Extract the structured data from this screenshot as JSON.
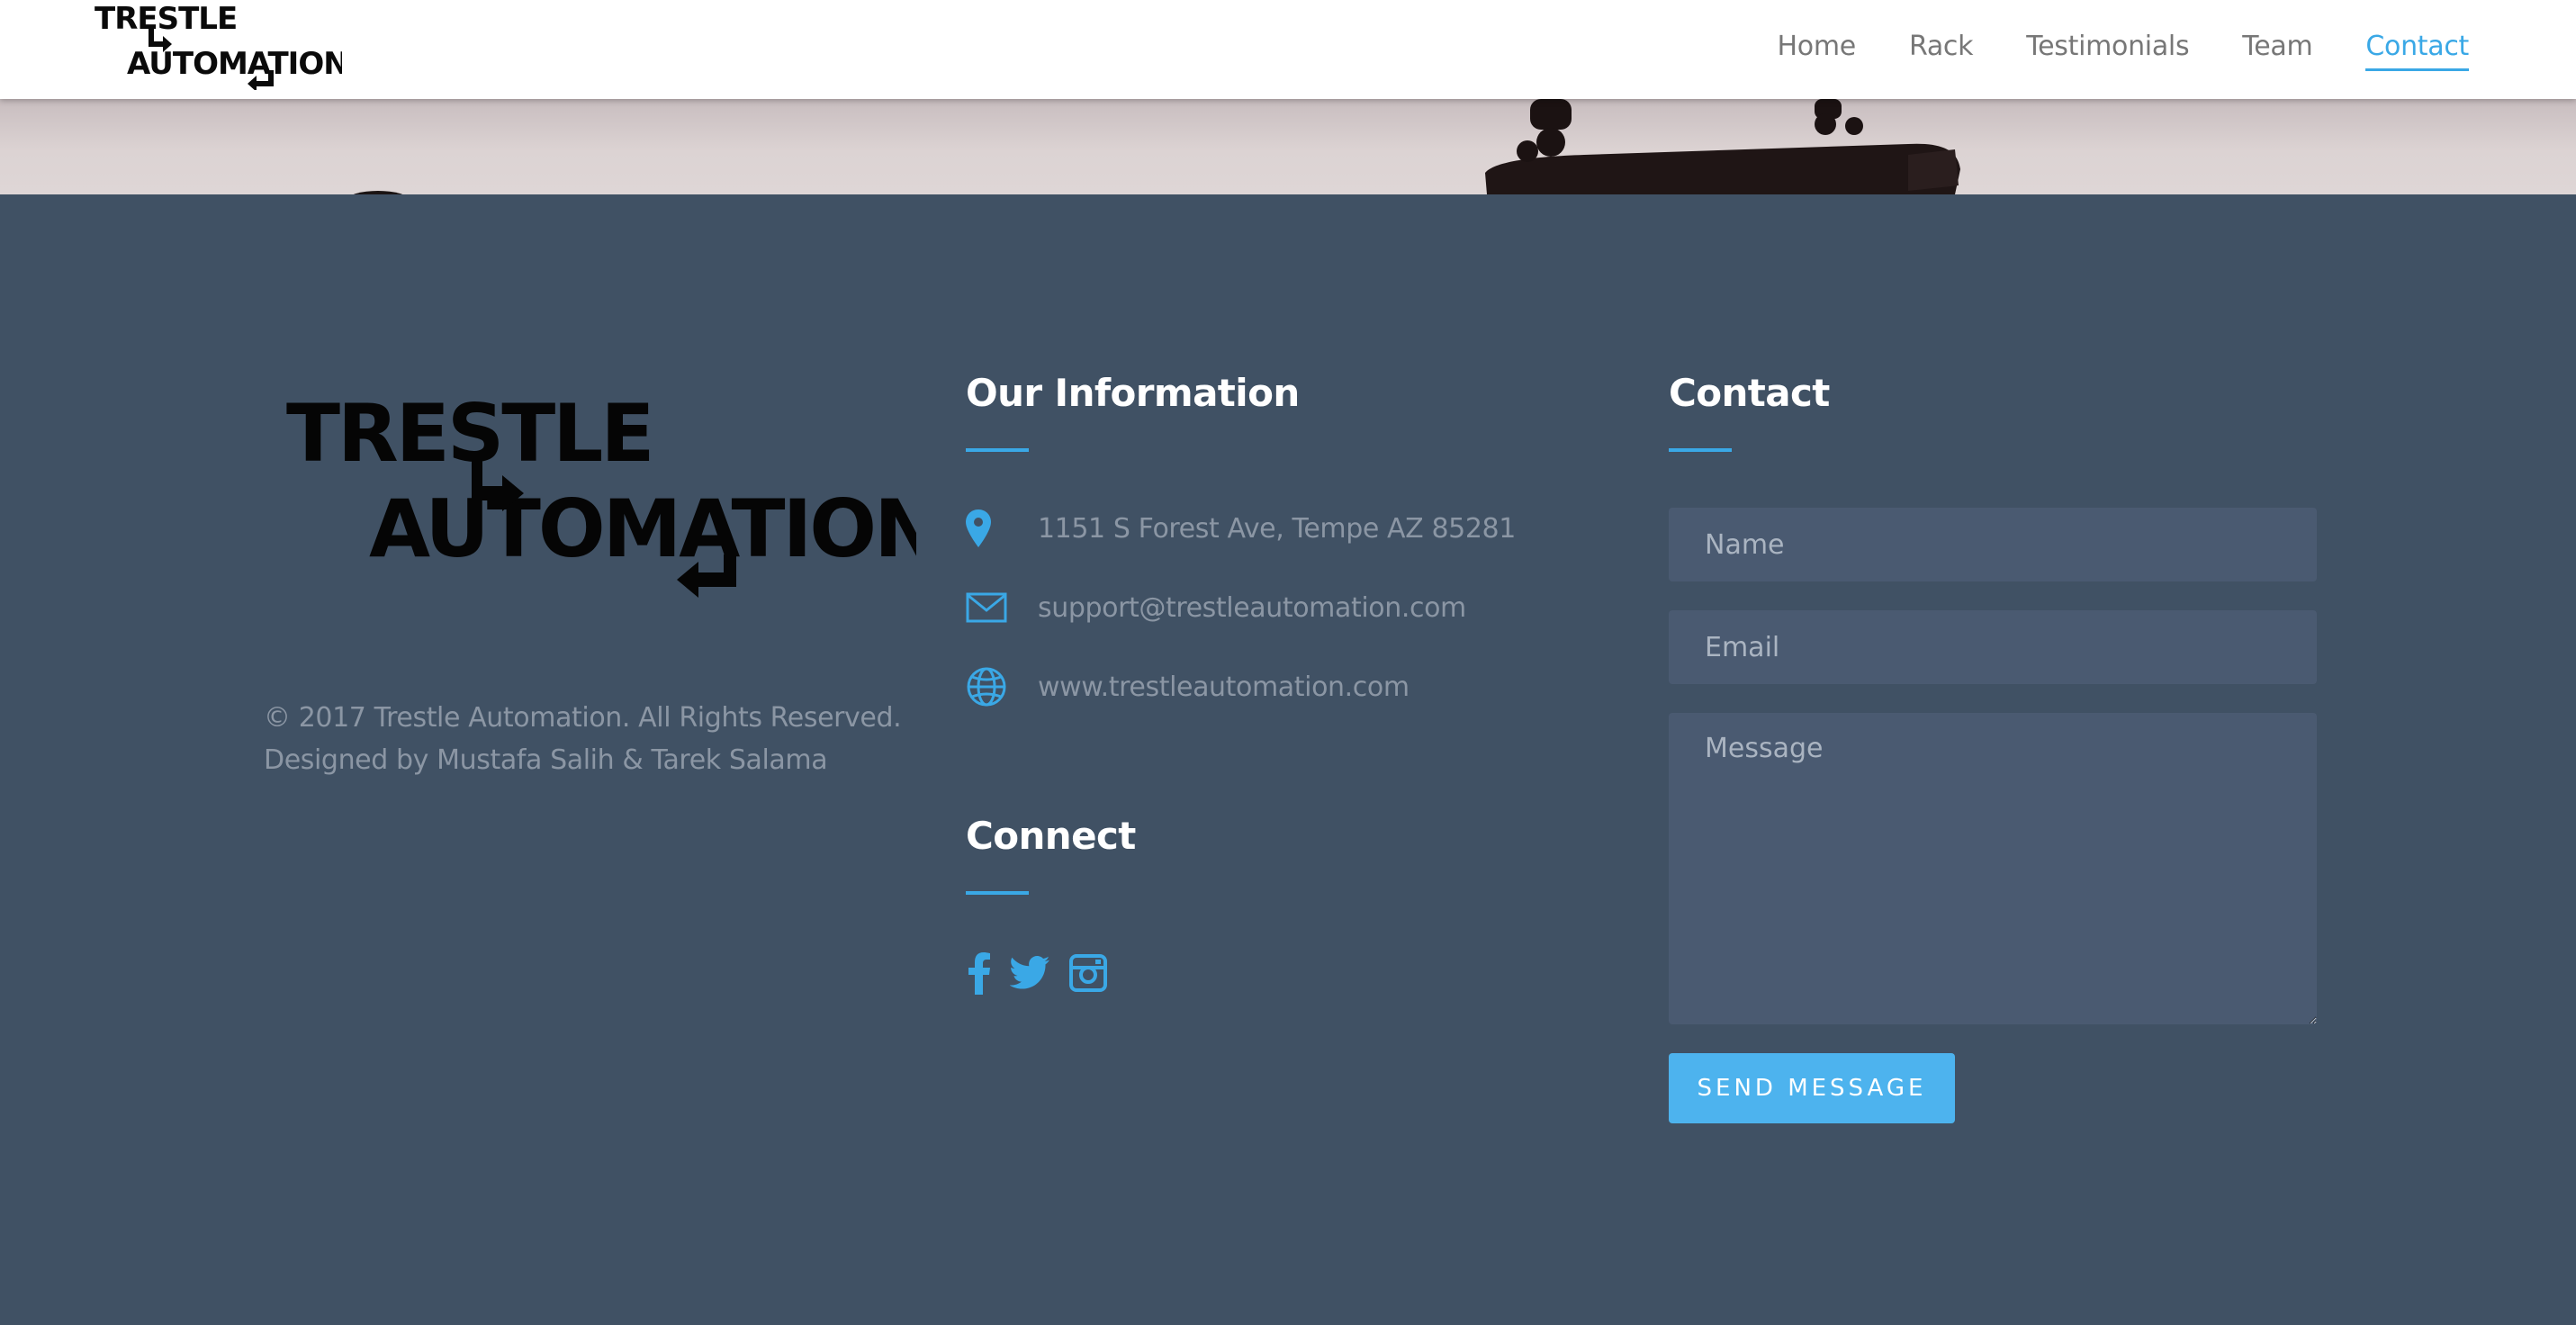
{
  "nav": {
    "logo_line1": "TRESTLE",
    "logo_line2": "AUTOMATION",
    "links": [
      {
        "label": "Home",
        "active": false
      },
      {
        "label": "Rack",
        "active": false
      },
      {
        "label": "Testimonials",
        "active": false
      },
      {
        "label": "Team",
        "active": false
      },
      {
        "label": "Contact",
        "active": true
      }
    ]
  },
  "footer": {
    "logo_line1": "TRESTLE",
    "logo_line2": "AUTOMATION",
    "copyright": "© 2017 Trestle Automation. All Rights Reserved.",
    "credits": "Designed by Mustafa Salih & Tarek Salama",
    "info": {
      "title": "Our Information",
      "address": "1151 S Forest Ave, Tempe AZ 85281",
      "email": "support@trestleautomation.com",
      "website": "www.trestleautomation.com"
    },
    "connect": {
      "title": "Connect",
      "icons": [
        "facebook-icon",
        "twitter-icon",
        "instagram-icon"
      ]
    },
    "contact": {
      "title": "Contact",
      "name_placeholder": "Name",
      "email_placeholder": "Email",
      "message_placeholder": "Message",
      "send_label": "SEND MESSAGE"
    }
  },
  "colors": {
    "footer_bg": "#405164",
    "accent": "#3aa8e6",
    "field_bg": "#4a5a71",
    "button_bg": "#4db3ee",
    "muted_text": "#8b96a4"
  }
}
